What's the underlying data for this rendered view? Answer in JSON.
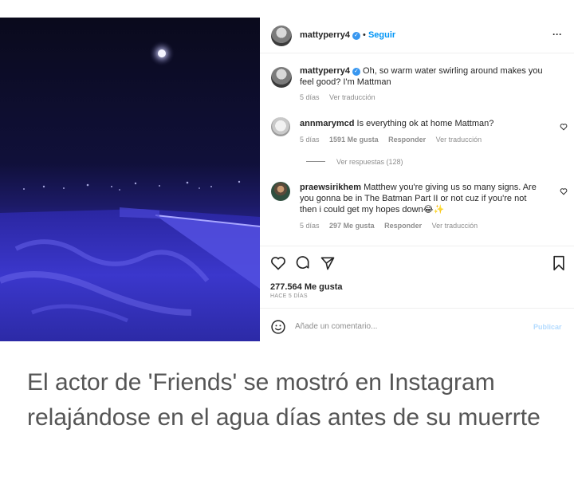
{
  "post": {
    "header": {
      "username": "mattyperry4",
      "follow_label": "Seguir",
      "more_label": "···"
    },
    "caption_comment": {
      "username": "mattyperry4",
      "text": "Oh, so warm water swirling around makes you feel good? I'm Mattman",
      "time": "5 días",
      "translate": "Ver traducción"
    },
    "comments": [
      {
        "username": "annmarymcd",
        "text": "Is everything ok at home Mattman?",
        "time": "5 días",
        "likes": "1591 Me gusta",
        "reply": "Responder",
        "translate": "Ver traducción",
        "view_replies": "Ver respuestas (128)"
      },
      {
        "username": "praewsirikhem",
        "text": "Matthew you're giving us so many signs. Are you gonna be in The Batman Part II or not cuz if you're not then i could get my hopes down😂✨",
        "time": "5 días",
        "likes": "297 Me gusta",
        "reply": "Responder",
        "translate": "Ver traducción"
      }
    ],
    "likes_count": "277.564 Me gusta",
    "posted_time": "HACE 5 DÍAS",
    "add_comment_placeholder": "Añade un comentario...",
    "publish_label": "Publicar"
  },
  "article_caption": "El actor de 'Friends' se mostró en Instagram relajándose en el agua días antes de su muerrte",
  "colors": {
    "verified": "#3897f0",
    "follow": "#0095f6",
    "water": "#3a36c4",
    "publish_disabled": "#b3dbff"
  },
  "icons": [
    "heart-icon",
    "comment-icon",
    "share-icon",
    "bookmark-icon",
    "emoji-icon",
    "more-icon",
    "verified-icon"
  ]
}
